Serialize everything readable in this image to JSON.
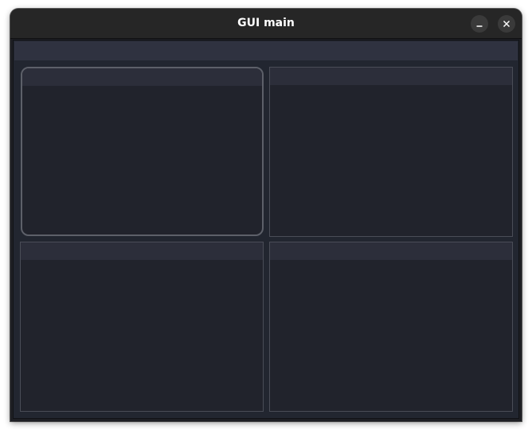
{
  "window": {
    "title": "GUI main",
    "controls": [
      "minimize-icon",
      "close-icon"
    ]
  },
  "colors": {
    "titlebar": "#262626",
    "background": "#222630",
    "menubar": "#2f3240",
    "panel": "#21232c",
    "panel_header": "#2c2e3a",
    "panel_border": "#4a4d57",
    "focus_border": "#5d6069"
  },
  "panels": [
    {
      "focused": true
    },
    {
      "focused": false
    },
    {
      "focused": false
    },
    {
      "focused": false
    }
  ]
}
